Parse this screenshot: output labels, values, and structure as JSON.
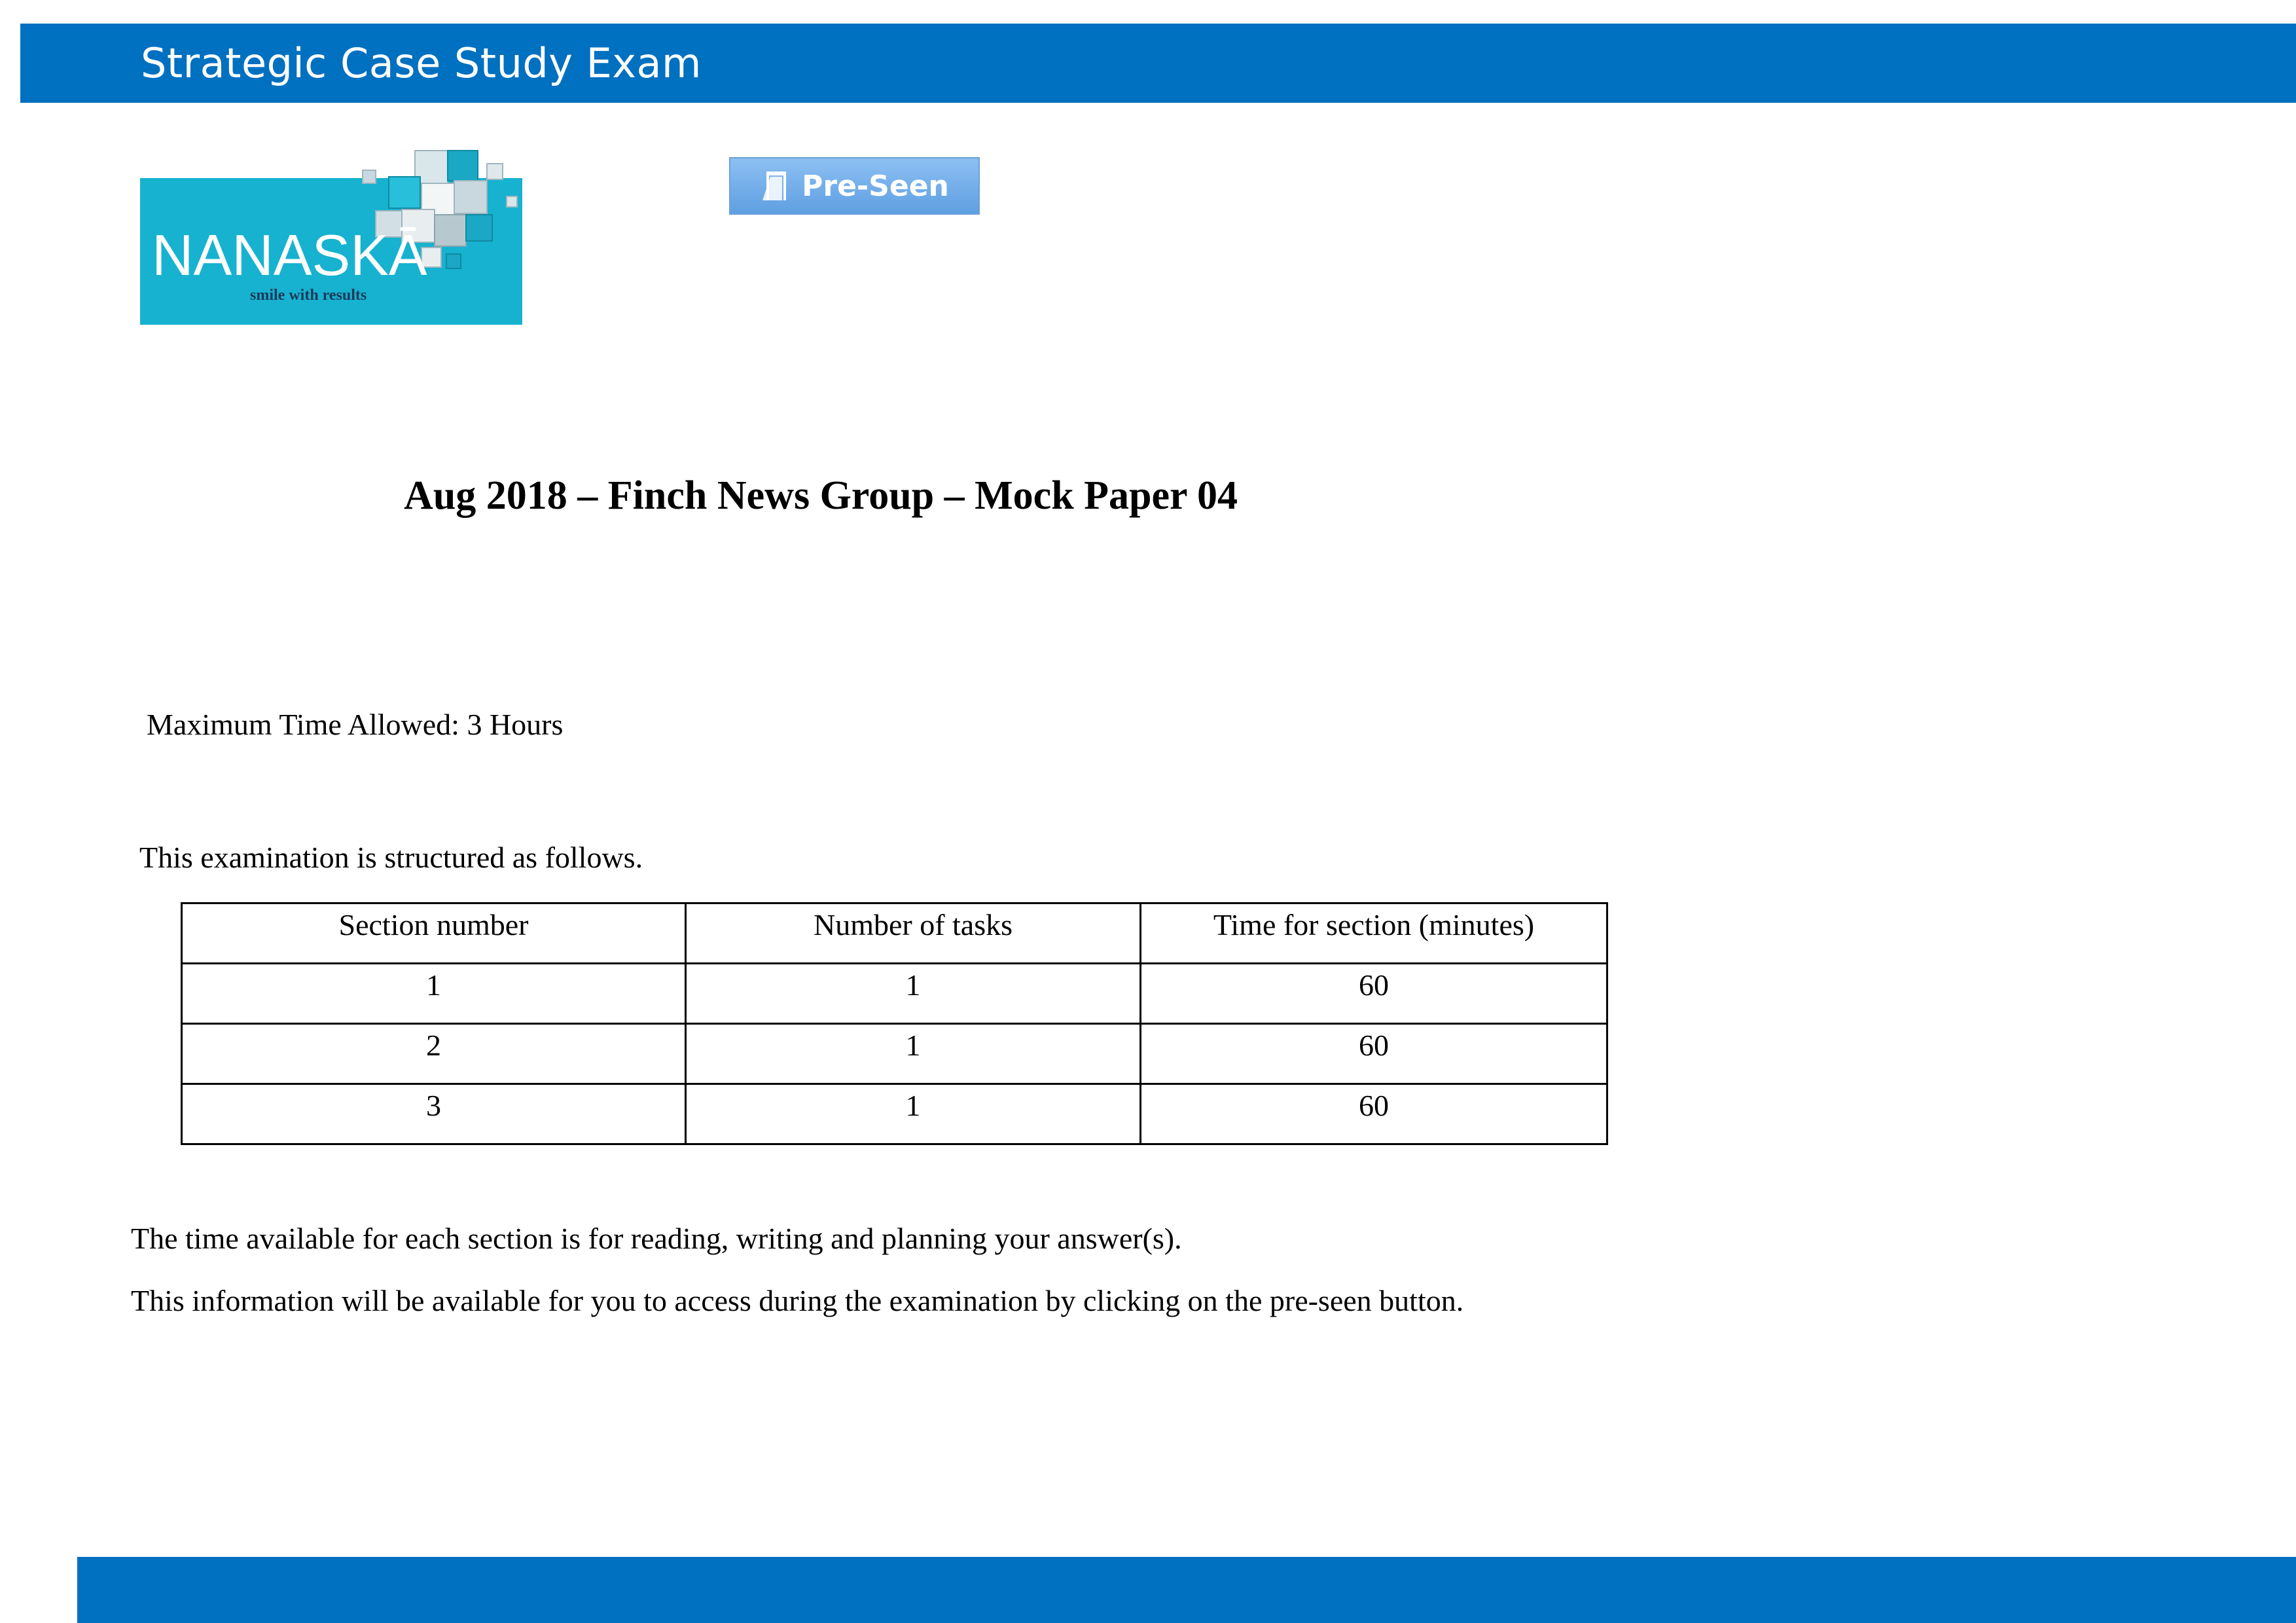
{
  "header": {
    "title": "Strategic Case Study Exam"
  },
  "logo": {
    "name": "NANASKĀ",
    "tagline": "smile with results",
    "color": "#16b2d0"
  },
  "preseen_button": {
    "label": "Pre-Seen",
    "icon": "document-icon"
  },
  "document": {
    "title": "Aug 2018 – Finch News Group – Mock Paper 04",
    "max_time": "Maximum Time Allowed: 3 Hours",
    "structure_intro": "This examination is structured as follows.",
    "table": {
      "headers": [
        "Section number",
        "Number of tasks",
        "Time for section (minutes)"
      ],
      "rows": [
        [
          "1",
          "1",
          "60"
        ],
        [
          "2",
          "1",
          "60"
        ],
        [
          "3",
          "1",
          "60"
        ]
      ]
    },
    "note_time": "The time available for each section is for reading, writing and planning your answer(s).",
    "note_access": "This information will be available for you to access during the examination by clicking on the pre-seen button."
  },
  "colors": {
    "banner": "#0070c0",
    "button": "#7fb4ec"
  }
}
